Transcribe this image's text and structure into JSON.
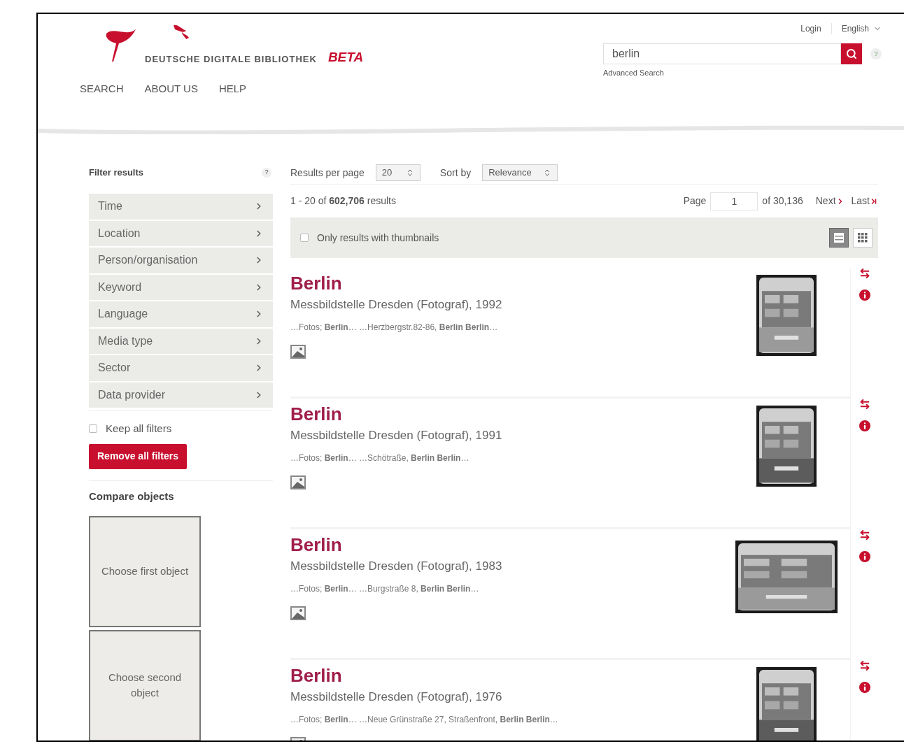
{
  "header": {
    "logo": {
      "name": "DEUTSCHE DIGITALE BIBLIOTHEK",
      "badge": "BETA"
    },
    "nav": [
      "SEARCH",
      "ABOUT US",
      "HELP"
    ],
    "login": "Login",
    "language": "English",
    "search": {
      "value": "berlin"
    },
    "advanced_search": "Advanced Search",
    "help": "?"
  },
  "sidebar": {
    "title": "Filter results",
    "help": "?",
    "filters": [
      "Time",
      "Location",
      "Person/organisation",
      "Keyword",
      "Language",
      "Media type",
      "Sector",
      "Data provider"
    ],
    "keep_filters": {
      "label": "Keep all filters",
      "checked": false
    },
    "remove_button": "Remove all filters",
    "compare_title": "Compare objects",
    "compare_slots": [
      "Choose first object",
      "Choose second object"
    ]
  },
  "toolbar": {
    "per_page_label": "Results per page",
    "per_page": "20",
    "sort_label": "Sort by",
    "sort": "Relevance"
  },
  "summary": "1 - 20 of **602,706** results",
  "pagination": {
    "page_label": "Page",
    "page": "1",
    "of": "of 30,136",
    "next": "Next",
    "last": "Last"
  },
  "thumbnail_filter": {
    "label": "Only results with thumbnails",
    "checked": false
  },
  "views": [
    {
      "kind": "list",
      "selected": true
    },
    {
      "kind": "grid",
      "selected": false
    }
  ],
  "results": [
    {
      "title": "Berlin",
      "subtitle": "Messbildstelle Dresden (Fotograf), 1992",
      "snippet": "…Fotos; **Berlin**… …Herzbergstr.82-86, **Berlin Berlin**…",
      "kind": "portrait"
    },
    {
      "title": "Berlin",
      "subtitle": "Messbildstelle Dresden (Fotograf), 1991",
      "snippet": "…Fotos; **Berlin**… …Schötraße, **Berlin Berlin**…",
      "kind": "portrait"
    },
    {
      "title": "Berlin",
      "subtitle": "Messbildstelle Dresden (Fotograf), 1983",
      "snippet": "…Fotos; **Berlin**… …Burgstraße 8, **Berlin Berlin**…",
      "kind": "landscape"
    },
    {
      "title": "Berlin",
      "subtitle": "Messbildstelle Dresden (Fotograf), 1976",
      "snippet": "…Fotos; **Berlin**… …Neue Grünstraße 27, Straßenfront, **Berlin Berlin**…",
      "kind": "portrait"
    }
  ]
}
